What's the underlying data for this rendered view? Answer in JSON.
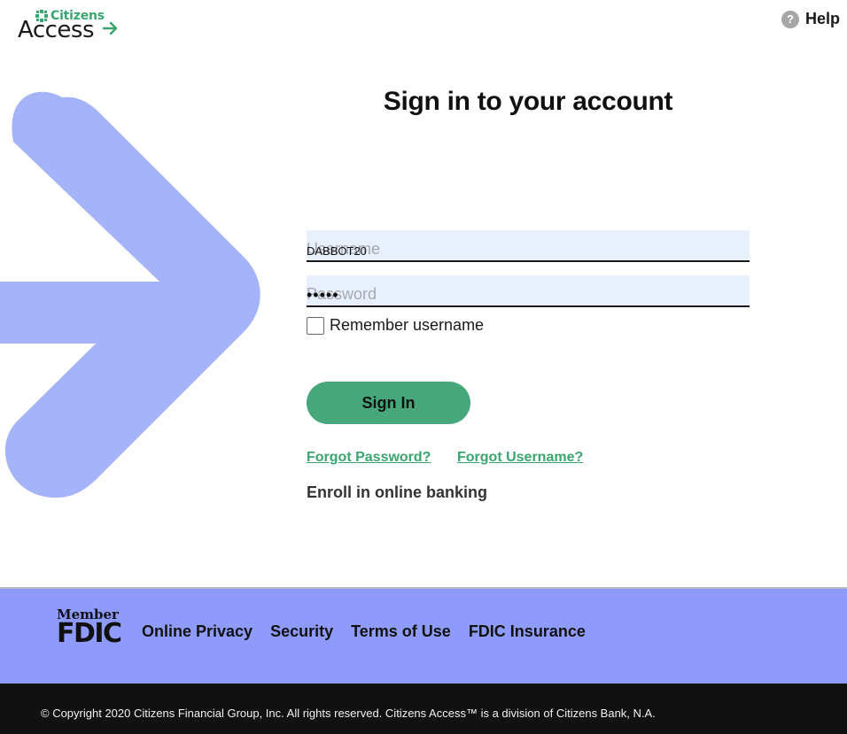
{
  "header": {
    "logo_top": "Citizens",
    "logo_bottom": "Access",
    "help_icon_glyph": "?",
    "help_label": "Help"
  },
  "form": {
    "title": "Sign in to your account",
    "username_placeholder": "Username",
    "username_value": "DABBOT20",
    "password_placeholder": "Password",
    "password_value": "•••••",
    "remember_label": "Remember username",
    "remember_checked": false,
    "signin_label": "Sign In",
    "forgot_password": "Forgot Password?",
    "forgot_username": "Forgot Username?",
    "enroll": "Enroll in online banking"
  },
  "footer": {
    "fdic_member": "Member",
    "fdic_logo": "FDIC",
    "links": [
      "Online Privacy",
      "Security",
      "Terms of Use",
      "FDIC Insurance"
    ],
    "copyright": "© Copyright 2020 Citizens Financial Group, Inc. All rights reserved. Citizens Access™ is a division of Citizens Bank, N.A."
  },
  "colors": {
    "brand_green": "#3aa56f",
    "button_green": "#46a87a",
    "hero_arrow": "#a5b3f8",
    "footer_bg": "#8e9bfa",
    "bottom_bar": "#111111",
    "input_bg": "#e9f0fd"
  },
  "icons": {
    "logo_star": "citizens-star-icon",
    "logo_arrow": "arrow-right-icon",
    "help": "question-circle-icon",
    "hero": "chevron-arrow-graphic"
  }
}
